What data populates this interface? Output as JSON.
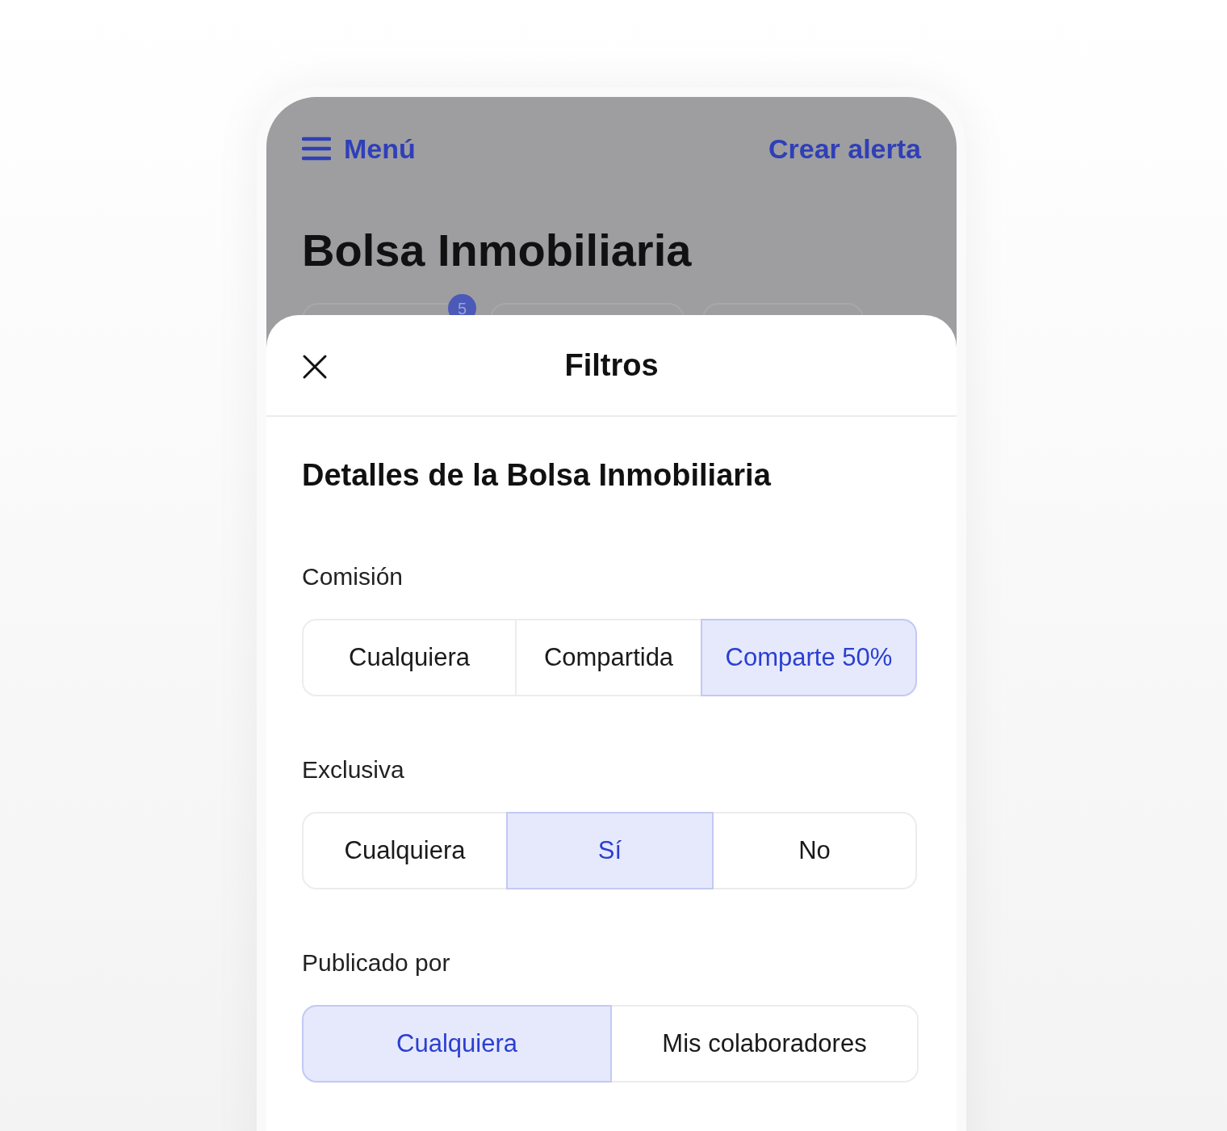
{
  "header": {
    "menu_label": "Menú",
    "action": "Crear alerta",
    "title": "Bolsa Inmobiliaria",
    "badge": "5"
  },
  "sheet": {
    "title": "Filtros",
    "section_title": "Detalles de la Bolsa Inmobiliaria",
    "groups": [
      {
        "label": "Comisión",
        "options": [
          {
            "label": "Cualquiera",
            "selected": false
          },
          {
            "label": "Compartida",
            "selected": false
          },
          {
            "label": "Comparte 50%",
            "selected": true
          }
        ]
      },
      {
        "label": "Exclusiva",
        "options": [
          {
            "label": "Cualquiera",
            "selected": false
          },
          {
            "label": "Sí",
            "selected": true
          },
          {
            "label": "No",
            "selected": false
          }
        ]
      },
      {
        "label": "Publicado por",
        "options": [
          {
            "label": "Cualquiera",
            "selected": true
          },
          {
            "label": "Mis colaboradores",
            "selected": false
          }
        ]
      }
    ]
  }
}
